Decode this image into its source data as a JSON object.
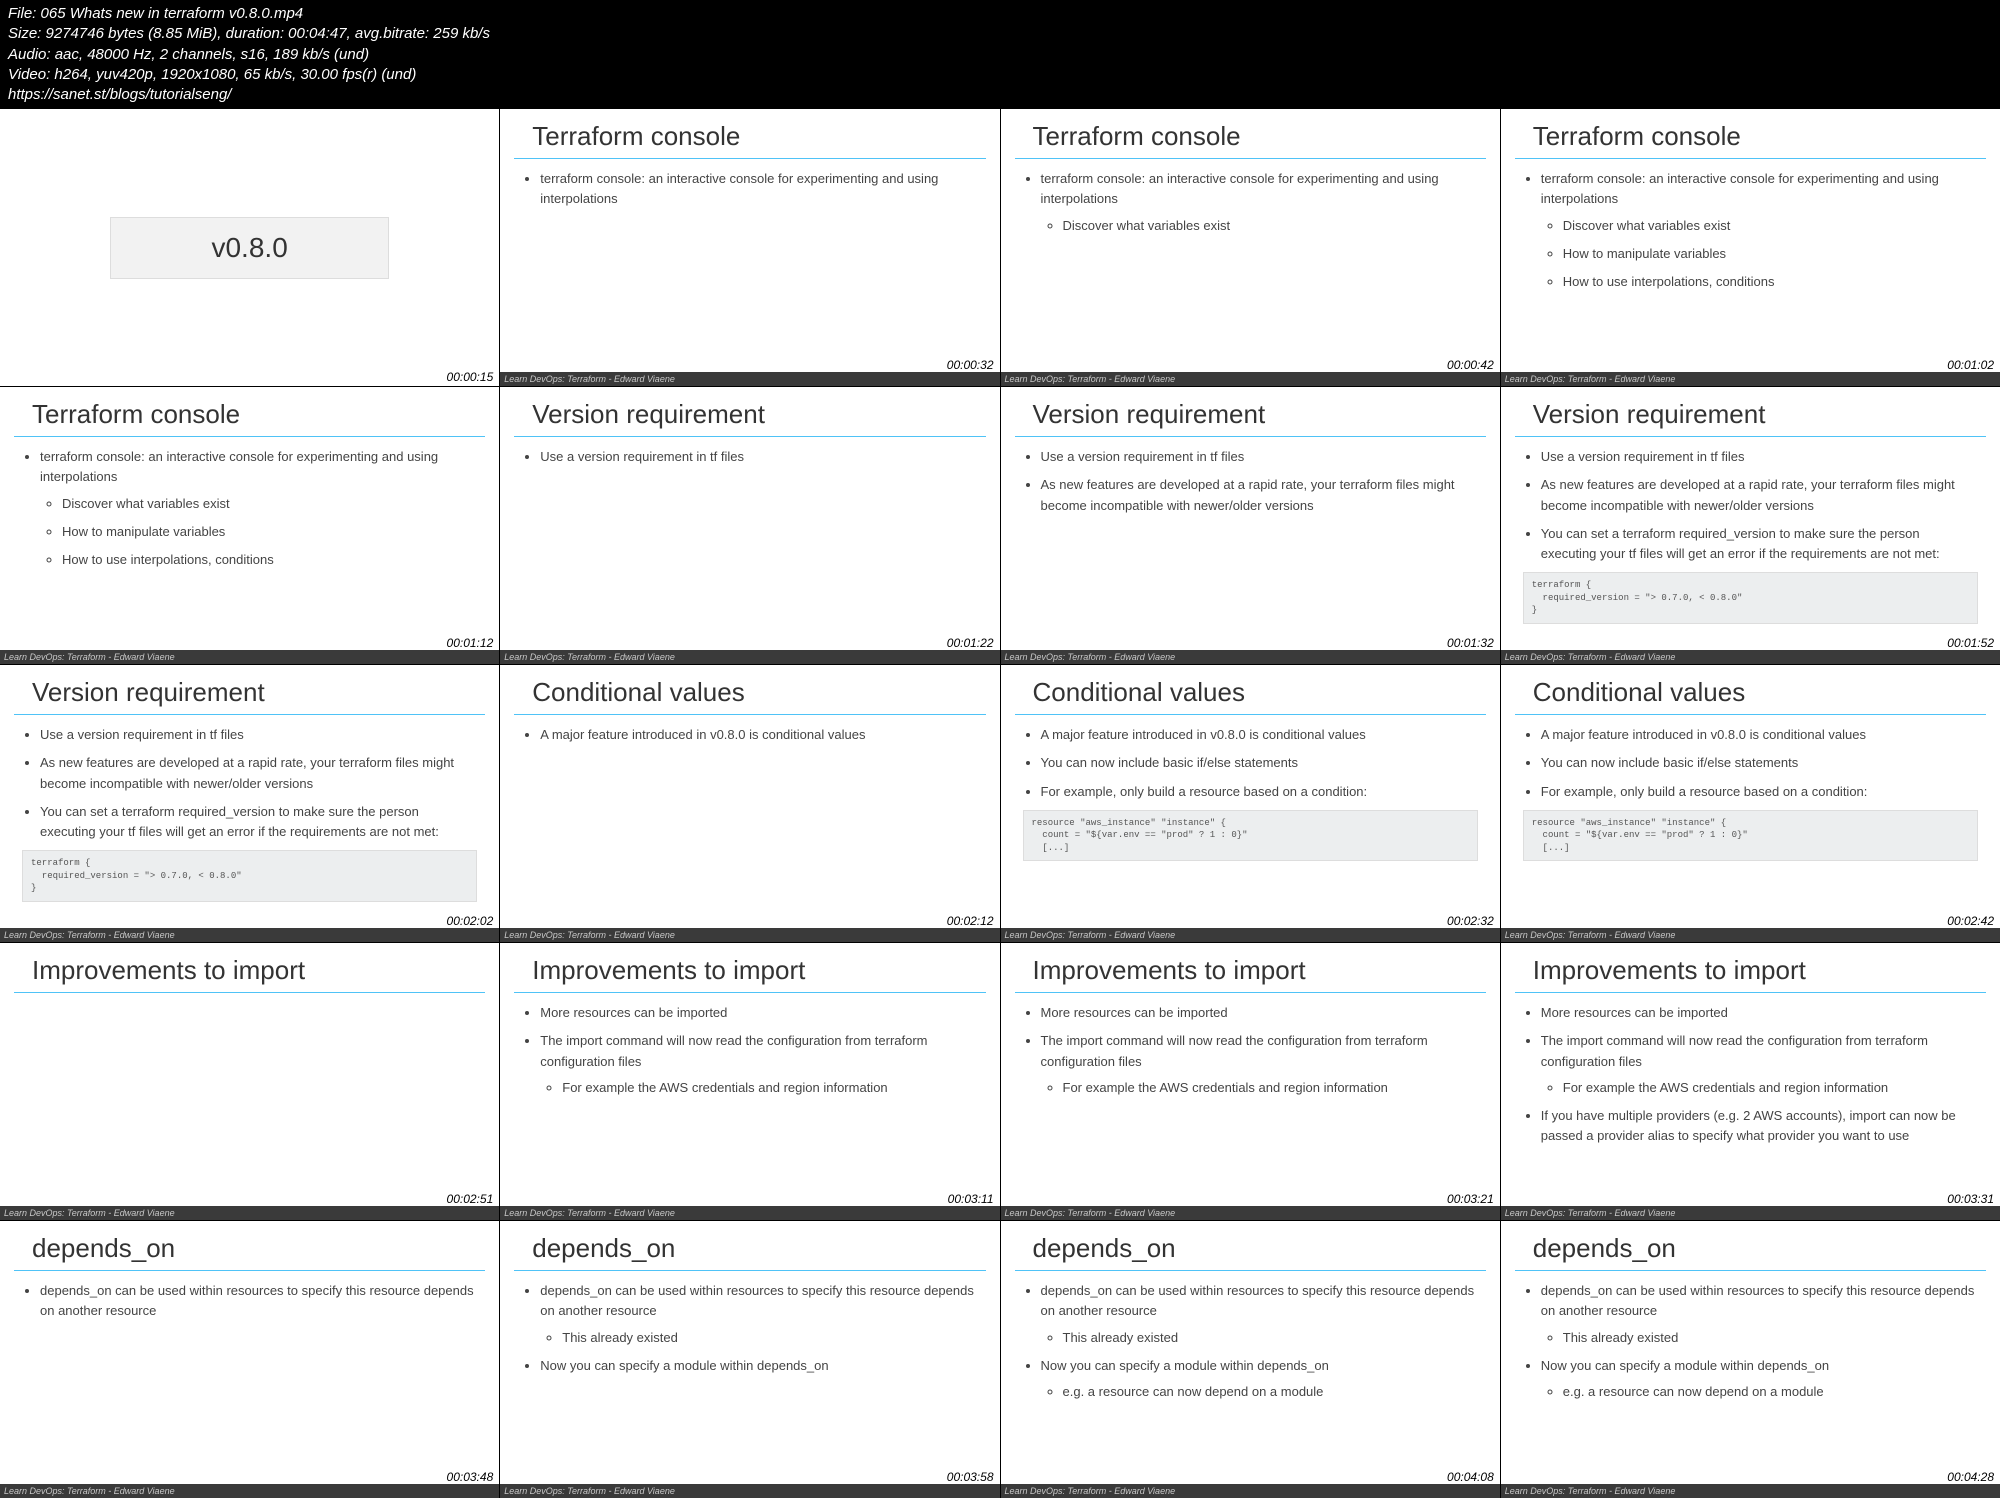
{
  "header": {
    "line1": "File: 065 Whats new in terraform v0.8.0.mp4",
    "line2": "Size: 9274746 bytes (8.85 MiB), duration: 00:04:47, avg.bitrate: 259 kb/s",
    "line3": "Audio: aac, 48000 Hz, 2 channels, s16, 189 kb/s (und)",
    "line4": "Video: h264, yuv420p, 1920x1080, 65 kb/s, 30.00 fps(r) (und)",
    "line5": "https://sanet.st/blogs/tutorialseng/"
  },
  "footer_text": "Learn DevOps: Terraform - Edward Viaene",
  "cells": [
    {
      "type": "title",
      "title": "v0.8.0",
      "timestamp": "00:00:15",
      "no_footer": true
    },
    {
      "type": "slide",
      "heading": "Terraform console",
      "timestamp": "00:00:32",
      "bullets": [
        "terraform console: an interactive console for experimenting and using interpolations"
      ]
    },
    {
      "type": "slide",
      "heading": "Terraform console",
      "timestamp": "00:00:42",
      "bullets": [
        "terraform console: an interactive console for experimenting and using interpolations"
      ],
      "sub": [
        "Discover what variables exist"
      ]
    },
    {
      "type": "slide",
      "heading": "Terraform console",
      "timestamp": "00:01:02",
      "bullets": [
        "terraform console: an interactive console for experimenting and using interpolations"
      ],
      "sub": [
        "Discover what variables exist",
        "How to manipulate variables",
        "How to use interpolations, conditions"
      ]
    },
    {
      "type": "slide",
      "heading": "Terraform console",
      "timestamp": "00:01:12",
      "bullets": [
        "terraform console: an interactive console for experimenting and using interpolations"
      ],
      "sub": [
        "Discover what variables exist",
        "How to manipulate variables",
        "How to use interpolations, conditions"
      ]
    },
    {
      "type": "slide",
      "heading": "Version requirement",
      "timestamp": "00:01:22",
      "bullets": [
        "Use a version requirement in tf files"
      ]
    },
    {
      "type": "slide",
      "heading": "Version requirement",
      "timestamp": "00:01:32",
      "bullets": [
        "Use a version requirement in tf files",
        "As new features are developed at a rapid rate, your terraform files might become incompatible with newer/older versions"
      ]
    },
    {
      "type": "slide",
      "heading": "Version requirement",
      "timestamp": "00:01:52",
      "bullets": [
        "Use a version requirement in tf files",
        "As new features are developed at a rapid rate, your terraform files might become incompatible with newer/older versions",
        "You can set a terraform required_version to make sure the person executing your tf files will get an error if the requirements are not met:"
      ],
      "code": "terraform {\n  required_version = \"> 0.7.0, < 0.8.0\"\n}"
    },
    {
      "type": "slide",
      "heading": "Version requirement",
      "timestamp": "00:02:02",
      "bullets": [
        "Use a version requirement in tf files",
        "As new features are developed at a rapid rate, your terraform files might become incompatible with newer/older versions",
        "You can set a terraform required_version to make sure the person executing your tf files will get an error if the requirements are not met:"
      ],
      "code": "terraform {\n  required_version = \"> 0.7.0, < 0.8.0\"\n}"
    },
    {
      "type": "slide",
      "heading": "Conditional values",
      "timestamp": "00:02:12",
      "bullets": [
        "A major feature introduced in v0.8.0 is conditional values"
      ]
    },
    {
      "type": "slide",
      "heading": "Conditional values",
      "timestamp": "00:02:32",
      "bullets": [
        "A major feature introduced in v0.8.0 is conditional values",
        "You can now include basic if/else statements",
        "For example, only build a resource based on a condition:"
      ],
      "code": "resource \"aws_instance\" \"instance\" {\n  count = \"${var.env == \"prod\" ? 1 : 0}\"\n  [...]"
    },
    {
      "type": "slide",
      "heading": "Conditional values",
      "timestamp": "00:02:42",
      "bullets": [
        "A major feature introduced in v0.8.0 is conditional values",
        "You can now include basic if/else statements",
        "For example, only build a resource based on a condition:"
      ],
      "code": "resource \"aws_instance\" \"instance\" {\n  count = \"${var.env == \"prod\" ? 1 : 0}\"\n  [...]"
    },
    {
      "type": "slide",
      "heading": "Improvements to import",
      "timestamp": "00:02:51",
      "bullets": []
    },
    {
      "type": "slide",
      "heading": "Improvements to import",
      "timestamp": "00:03:11",
      "bullets": [
        "More resources can be imported",
        "The import command will now read the configuration from terraform configuration files"
      ],
      "sub2": [
        "For example the AWS credentials and region information"
      ]
    },
    {
      "type": "slide",
      "heading": "Improvements to import",
      "timestamp": "00:03:21",
      "bullets": [
        "More resources can be imported",
        "The import command will now read the configuration from terraform configuration files"
      ],
      "sub2": [
        "For example the AWS credentials and region information"
      ]
    },
    {
      "type": "slide",
      "heading": "Improvements to import",
      "timestamp": "00:03:31",
      "bullets": [
        "More resources can be imported",
        "The import command will now read the configuration from terraform configuration files"
      ],
      "sub2": [
        "For example the AWS credentials and region information"
      ],
      "extra": [
        "If you have multiple providers (e.g. 2 AWS accounts), import can now be passed a provider alias to specify what provider you want to use"
      ]
    },
    {
      "type": "slide",
      "heading": "depends_on",
      "timestamp": "00:03:48",
      "bullets": [
        "depends_on can be used within resources to specify this resource depends on another resource"
      ]
    },
    {
      "type": "slide",
      "heading": "depends_on",
      "timestamp": "00:03:58",
      "bullets": [
        "depends_on can be used within resources to specify this resource depends on another resource"
      ],
      "sub": [
        "This already existed"
      ],
      "extra": [
        "Now you can specify a module within depends_on"
      ]
    },
    {
      "type": "slide",
      "heading": "depends_on",
      "timestamp": "00:04:08",
      "bullets": [
        "depends_on can be used within resources to specify this resource depends on another resource"
      ],
      "sub": [
        "This already existed"
      ],
      "extra": [
        "Now you can specify a module within depends_on"
      ],
      "extrasub": [
        "e.g. a resource can now depend on a module"
      ]
    },
    {
      "type": "slide",
      "heading": "depends_on",
      "timestamp": "00:04:28",
      "bullets": [
        "depends_on can be used within resources to specify this resource depends on another resource"
      ],
      "sub": [
        "This already existed"
      ],
      "extra": [
        "Now you can specify a module within depends_on"
      ],
      "extrasub": [
        "e.g. a resource can now depend on a module"
      ]
    }
  ]
}
